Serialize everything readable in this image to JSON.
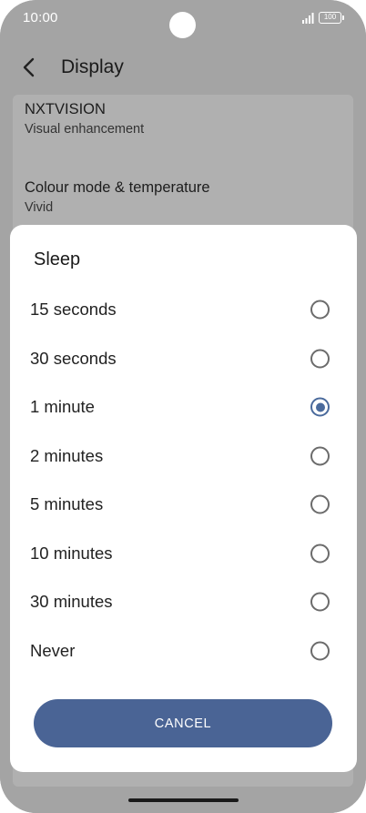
{
  "status_bar": {
    "time": "10:00",
    "battery_level": "100",
    "signal_icon": "signal-icon",
    "battery_icon": "battery-icon"
  },
  "header": {
    "back_icon": "chevron-left-icon",
    "title": "Display"
  },
  "settings": [
    {
      "title": "NXTVISION",
      "subtitle": "Visual enhancement"
    },
    {
      "title": "Colour mode & temperature",
      "subtitle": "Vivid"
    }
  ],
  "dialog": {
    "title": "Sleep",
    "options": [
      {
        "label": "15 seconds",
        "selected": false
      },
      {
        "label": "30 seconds",
        "selected": false
      },
      {
        "label": "1 minute",
        "selected": true
      },
      {
        "label": "2 minutes",
        "selected": false
      },
      {
        "label": "5 minutes",
        "selected": false
      },
      {
        "label": "10 minutes",
        "selected": false
      },
      {
        "label": "30 minutes",
        "selected": false
      },
      {
        "label": "Never",
        "selected": false
      }
    ],
    "cancel_label": "CANCEL"
  },
  "colors": {
    "accent": "#4a6495",
    "radio_selected": "#4a6a9c",
    "scrim": "#a4a4a4"
  }
}
